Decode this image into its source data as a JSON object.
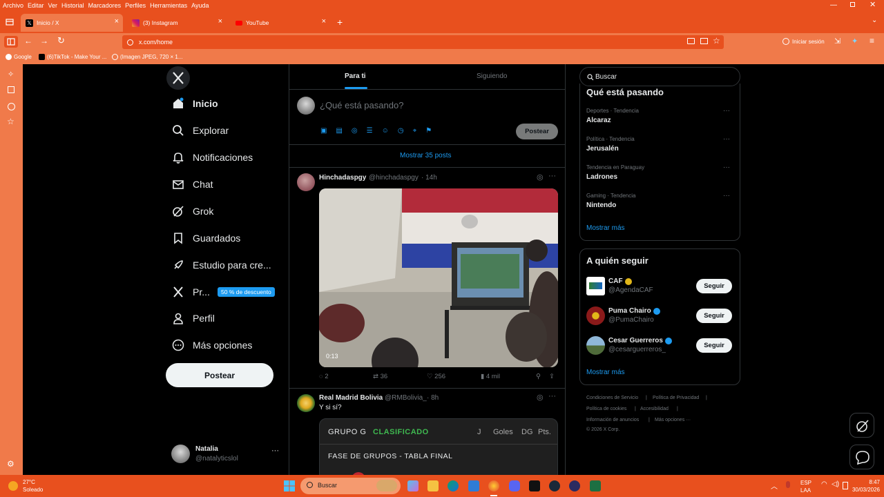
{
  "browser": {
    "menu": [
      "Archivo",
      "Editar",
      "Ver",
      "Historial",
      "Marcadores",
      "Perfiles",
      "Herramientas",
      "Ayuda"
    ],
    "tabs": [
      {
        "title": "Inicio / X",
        "active": true
      },
      {
        "title": "(3) Instagram",
        "active": false
      },
      {
        "title": "YouTube",
        "active": false
      }
    ],
    "url": "x.com/home",
    "sign_in": "Iniciar sesión",
    "bookmarks": [
      "Google",
      "(6)TikTok - Make Your ...",
      "(Imagen JPEG, 720 × 1..."
    ]
  },
  "nav": {
    "items": [
      {
        "label": "Inicio",
        "icon": "home-icon"
      },
      {
        "label": "Explorar",
        "icon": "search-icon"
      },
      {
        "label": "Notificaciones",
        "icon": "bell-icon"
      },
      {
        "label": "Chat",
        "icon": "mail-icon"
      },
      {
        "label": "Grok",
        "icon": "grok-icon"
      },
      {
        "label": "Guardados",
        "icon": "bookmark-icon"
      },
      {
        "label": "Estudio para cre...",
        "icon": "rocket-icon"
      },
      {
        "label": "Pr...",
        "icon": "x-logo-icon"
      },
      {
        "label": "Perfil",
        "icon": "person-icon"
      },
      {
        "label": "Más opciones",
        "icon": "more-circle-icon"
      }
    ],
    "premium_badge": "50 % de descuento",
    "post_button": "Postear",
    "user": {
      "name": "Natalia",
      "handle": "@natalyticslol"
    }
  },
  "feed": {
    "tabs": [
      "Para ti",
      "Siguiendo"
    ],
    "compose_placeholder": "¿Qué está pasando?",
    "compose_post": "Postear",
    "show_posts": "Mostrar 35 posts",
    "posts": [
      {
        "name": "Hinchadaspgy",
        "handle": "@hinchadaspgy",
        "time": "· 14h",
        "video_time": "0:13",
        "stats": {
          "replies": "2",
          "reposts": "36",
          "likes": "256",
          "views": "4 mil"
        }
      },
      {
        "name": "Real Madrid Bolivia",
        "handle": "@RMBolivia_",
        "time": "· 8h",
        "text": "Y si sí?",
        "table": {
          "group": "GRUPO G",
          "status": "CLASIFICADO",
          "cols": [
            "J",
            "Goles",
            "DG",
            "Pts."
          ],
          "subtitle": "FASE DE GRUPOS - TABLA FINAL"
        }
      }
    ]
  },
  "right": {
    "search_placeholder": "Buscar",
    "trends_title": "Qué está pasando",
    "trends": [
      {
        "meta": "Deportes · Tendencia",
        "name": "Alcaraz"
      },
      {
        "meta": "Política · Tendencia",
        "name": "Jerusalén"
      },
      {
        "meta": "Tendencia en Paraguay",
        "name": "Ladrones"
      },
      {
        "meta": "Gaming · Tendencia",
        "name": "Nintendo"
      }
    ],
    "show_more": "Mostrar más",
    "follow_title": "A quién seguir",
    "follow": [
      {
        "name": "CAF",
        "handle": "@AgendaCAF",
        "button": "Seguir",
        "verified_color": "#e2b719"
      },
      {
        "name": "Puma Chairo",
        "handle": "@PumaChairo",
        "button": "Seguir",
        "verified_color": "#1d9bf0"
      },
      {
        "name": "Cesar Guerreros",
        "handle": "@cesarguerreros_",
        "button": "Seguir",
        "verified_color": "#1d9bf0"
      }
    ],
    "show_more_follow": "Mostrar más",
    "footer": [
      "Condiciones de Servicio",
      "|",
      "Política de Privacidad",
      "|",
      "Política de cookies",
      "|",
      "Accesibilidad",
      "|",
      "Información de anuncios",
      "|",
      "Más opciones ···",
      "© 2026 X Corp."
    ]
  },
  "taskbar": {
    "weather_temp": "27°C",
    "weather_desc": "Soleado",
    "search": "Buscar",
    "lang1": "ESP",
    "lang2": "LAA",
    "time": "8:47",
    "date": "30/03/2026"
  },
  "colors": {
    "browser_accent": "#e8501e",
    "browser_light": "#f07a4a",
    "x_blue": "#1d9bf0",
    "x_bg": "#000000"
  }
}
